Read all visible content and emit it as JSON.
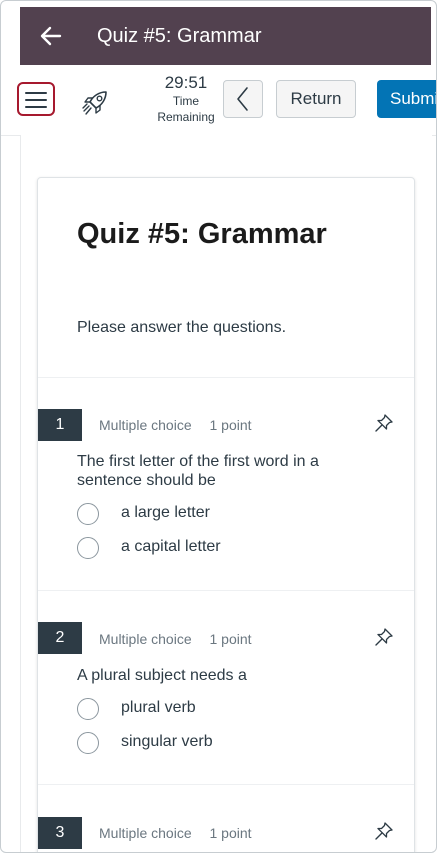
{
  "header": {
    "title": "Quiz #5: Grammar"
  },
  "toolbar": {
    "timer_value": "29:51",
    "timer_label_line1": "Time",
    "timer_label_line2": "Remaining",
    "return_label": "Return",
    "submit_label": "Submit"
  },
  "quiz": {
    "title": "Quiz #5: Grammar",
    "instructions": "Please answer the questions."
  },
  "questions": [
    {
      "number": "1",
      "type": "Multiple choice",
      "points": "1 point",
      "text": "The first letter of the first word in a sentence should be",
      "answers": [
        "a large letter",
        "a capital letter"
      ]
    },
    {
      "number": "2",
      "type": "Multiple choice",
      "points": "1 point",
      "text": "A plural subject needs a",
      "answers": [
        "plural verb",
        "singular verb"
      ]
    },
    {
      "number": "3",
      "type": "Multiple choice",
      "points": "1 point"
    }
  ],
  "icons": {
    "back": "arrow-left-icon",
    "menu": "hamburger-menu-icon",
    "rocket": "rocket-icon",
    "prev": "chevron-left-icon",
    "pin": "pin-icon"
  },
  "colors": {
    "header_bg": "#52414f",
    "submit_bg": "#0374b5",
    "question_badge": "#2d3b45",
    "focus_ring": "#a6192e"
  }
}
